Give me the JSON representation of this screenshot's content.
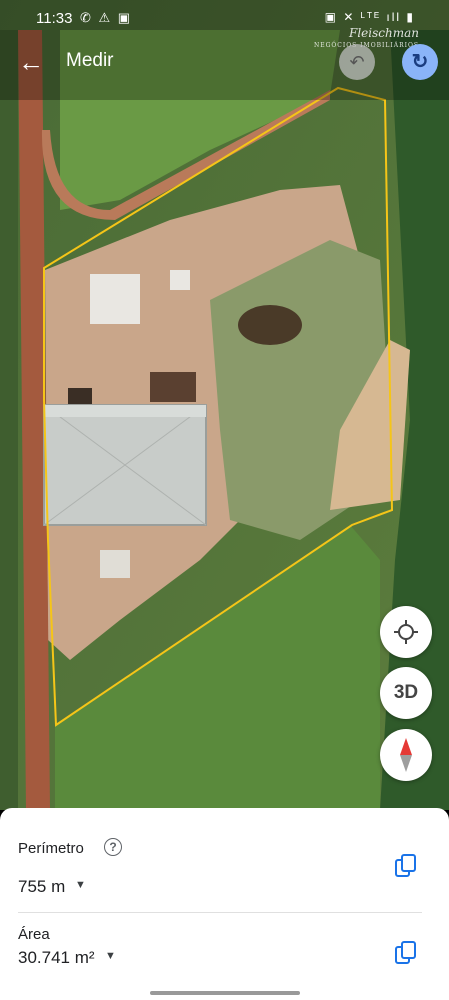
{
  "status_bar": {
    "time": "11:33",
    "left_icons": "✆ ⚠ ▣",
    "right_icons": "▣ ✕ ᴸᵀᴱ ıll ▮"
  },
  "watermark": {
    "name": "Fleischman",
    "tagline": "NEGÓCIOS IMOBILIÁRIOS"
  },
  "toolbar": {
    "back_icon": "arrow-left-icon",
    "title": "Medir",
    "undo_icon": "undo-icon",
    "redo_icon": "redo-icon"
  },
  "map_controls": {
    "locate_icon": "crosshair-icon",
    "three_d_label": "3D",
    "compass_icon": "compass-icon"
  },
  "measurements": {
    "perimeter_label": "Perímetro",
    "perimeter_value": "755 m",
    "area_label": "Área",
    "area_value": "30.741 m²"
  },
  "colors": {
    "boundary": "#f5c518",
    "accent": "#1a73e8",
    "redo_bg": "#8ab4f8"
  }
}
